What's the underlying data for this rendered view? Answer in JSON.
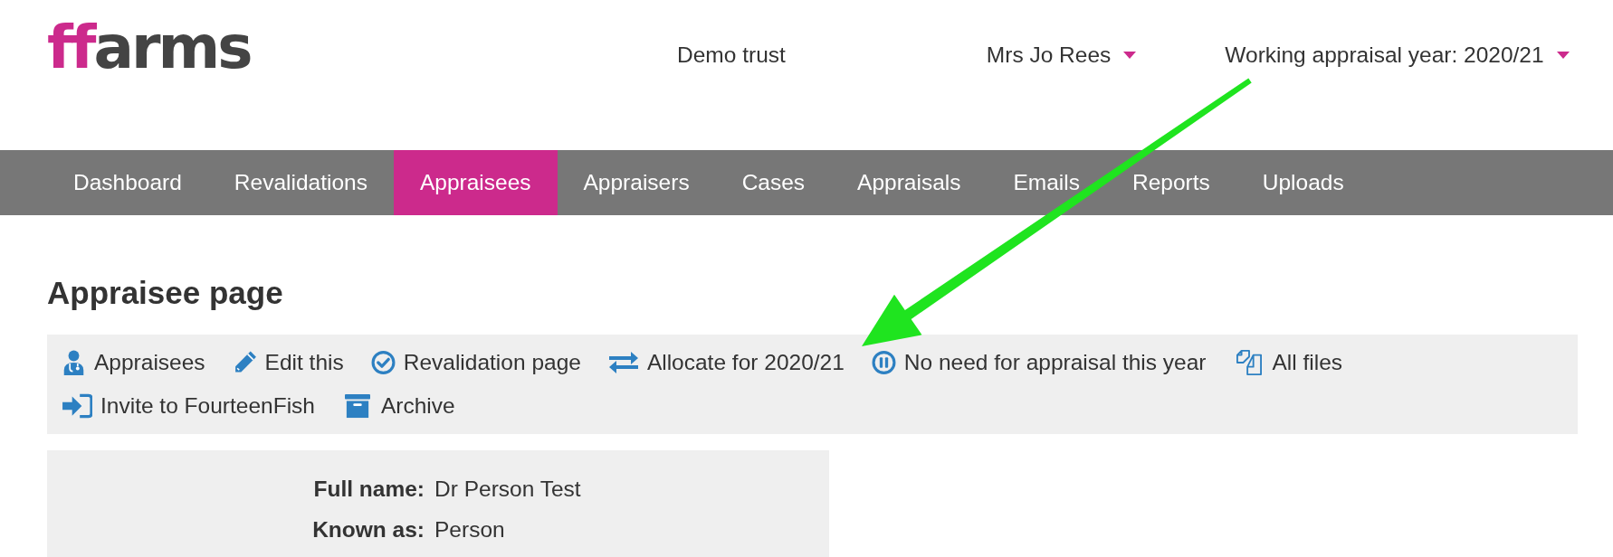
{
  "logo": {
    "accent_text": "ff",
    "text": "arms"
  },
  "header": {
    "organisation": "Demo trust",
    "user_menu": {
      "label": "Mrs Jo Rees"
    },
    "year_menu": {
      "label": "Working appraisal year: 2020/21"
    }
  },
  "nav": {
    "tabs": [
      {
        "label": "Dashboard",
        "selected": false
      },
      {
        "label": "Revalidations",
        "selected": false
      },
      {
        "label": "Appraisees",
        "selected": true
      },
      {
        "label": "Appraisers",
        "selected": false
      },
      {
        "label": "Cases",
        "selected": false
      },
      {
        "label": "Appraisals",
        "selected": false
      },
      {
        "label": "Emails",
        "selected": false
      },
      {
        "label": "Reports",
        "selected": false
      },
      {
        "label": "Uploads",
        "selected": false
      }
    ]
  },
  "page_title": "Appraisee page",
  "actions": [
    {
      "kind": "appraisees",
      "label": "Appraisees"
    },
    {
      "kind": "edit",
      "label": "Edit this"
    },
    {
      "kind": "revalidation",
      "label": "Revalidation page"
    },
    {
      "kind": "allocate",
      "label": "Allocate for 2020/21"
    },
    {
      "kind": "no_need",
      "label": "No need for appraisal this year"
    },
    {
      "kind": "files",
      "label": "All files"
    },
    {
      "kind": "invite",
      "label": "Invite to FourteenFish"
    },
    {
      "kind": "archive",
      "label": "Archive"
    }
  ],
  "details": [
    {
      "label": "Full name:",
      "value": "Dr Person Test"
    },
    {
      "label": "Known as:",
      "value": "Person"
    }
  ]
}
